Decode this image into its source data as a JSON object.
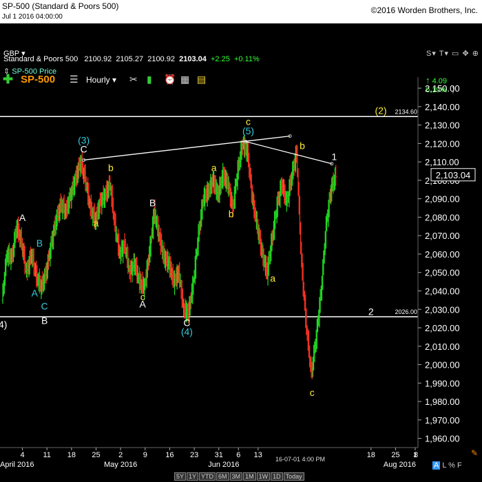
{
  "header": {
    "title": "SP-500 (Standard & Poors 500)",
    "datetime": "Jul 1 2016 04:00:00",
    "copyright": "©2016 Worden Brothers, Inc."
  },
  "toolbar": {
    "currency": "GBP",
    "symbol": "SP-500",
    "interval": "Hourly",
    "change_abs": "4.09",
    "change_pct": "0.19%",
    "right_tools": "S▾ T▾ ▭ ✥ ⊕"
  },
  "quote": {
    "name": "Standard & Poors 500",
    "open": "2100.92",
    "high": "2105.27",
    "low": "2100.92",
    "close": "2103.04",
    "change": "+2.25",
    "change_pct": "+0.11%"
  },
  "series_label": "SP-500 Price",
  "bottom": {
    "ranges": [
      "5Y",
      "1Y",
      "YTD",
      "6M",
      "3M",
      "1M",
      "1W",
      "1D",
      "Today"
    ],
    "mode_a": "A",
    "mode_rest": "L % F"
  },
  "chart_data": {
    "type": "bar",
    "subtype": "ohlc-hourly",
    "y_range": [
      1955,
      2156
    ],
    "y_ticks": [
      1960,
      1970,
      1980,
      1990,
      2000,
      2010,
      2020,
      2030,
      2040,
      2050,
      2060,
      2070,
      2080,
      2090,
      2100,
      2110,
      2120,
      2130,
      2140,
      2150
    ],
    "y_tick_labels": [
      "1,960.00",
      "1,970.00",
      "1,980.00",
      "1,990.00",
      "2,000.00",
      "2,010.00",
      "2,020.00",
      "2,030.00",
      "2,040.00",
      "2,050.00",
      "2,060.00",
      "2,070.00",
      "2,080.00",
      "2,090.00",
      "2,100.00",
      "2,110.00",
      "2,120.00",
      "2,130.00",
      "2,140.00",
      "2,150.00"
    ],
    "x_range": [
      0,
      84
    ],
    "x_ticks": [
      {
        "label": "4",
        "x": 4
      },
      {
        "label": "11",
        "x": 9
      },
      {
        "label": "18",
        "x": 14
      },
      {
        "label": "25",
        "x": 19
      },
      {
        "label": "2",
        "x": 24
      },
      {
        "label": "9",
        "x": 29
      },
      {
        "label": "16",
        "x": 34
      },
      {
        "label": "23",
        "x": 39
      },
      {
        "label": "31",
        "x": 44
      },
      {
        "label": "6",
        "x": 48
      },
      {
        "label": "13",
        "x": 52
      },
      {
        "label": "18",
        "x": 75
      },
      {
        "label": "25",
        "x": 80
      },
      {
        "label": "1",
        "x": 84
      }
    ],
    "extra_x_labels": [
      "8"
    ],
    "month_labels": [
      {
        "label": "April 2016",
        "x": 1
      },
      {
        "label": "May 2016",
        "x": 24
      },
      {
        "label": "Jun 2016",
        "x": 45
      },
      {
        "label": "Aug 2016",
        "x": 84
      }
    ],
    "x_cursor_label": "16-07-01 4:00 PM",
    "last_price_label": "2,103.04",
    "last_price": 2103.04,
    "horizontal_lines": [
      {
        "value": 2134.6,
        "label": "2134.60"
      },
      {
        "value": 2026.0,
        "label": "2026.00"
      }
    ],
    "trendlines": [
      {
        "points": [
          [
            16.5,
            2111
          ],
          [
            58.5,
            2124
          ]
        ]
      },
      {
        "points": [
          [
            49.5,
            2121
          ],
          [
            67,
            2109
          ]
        ]
      }
    ],
    "price_path": [
      [
        0,
        2035
      ],
      [
        1,
        2060
      ],
      [
        2,
        2058
      ],
      [
        3,
        2075
      ],
      [
        4,
        2066
      ],
      [
        5,
        2050
      ],
      [
        6,
        2060
      ],
      [
        7,
        2048
      ],
      [
        8,
        2042
      ],
      [
        9,
        2050
      ],
      [
        10,
        2065
      ],
      [
        11,
        2078
      ],
      [
        12,
        2087
      ],
      [
        13,
        2083
      ],
      [
        14,
        2092
      ],
      [
        15,
        2101
      ],
      [
        16,
        2110
      ],
      [
        17,
        2100
      ],
      [
        18,
        2085
      ],
      [
        19,
        2078
      ],
      [
        20,
        2088
      ],
      [
        21,
        2092
      ],
      [
        22,
        2098
      ],
      [
        23,
        2075
      ],
      [
        24,
        2060
      ],
      [
        25,
        2065
      ],
      [
        26,
        2050
      ],
      [
        27,
        2055
      ],
      [
        28,
        2045
      ],
      [
        29,
        2042
      ],
      [
        30,
        2060
      ],
      [
        31,
        2083
      ],
      [
        32,
        2070
      ],
      [
        33,
        2058
      ],
      [
        34,
        2055
      ],
      [
        35,
        2045
      ],
      [
        36,
        2050
      ],
      [
        37,
        2030
      ],
      [
        38,
        2028
      ],
      [
        39,
        2045
      ],
      [
        40,
        2070
      ],
      [
        41,
        2090
      ],
      [
        42,
        2094
      ],
      [
        43,
        2100
      ],
      [
        44,
        2092
      ],
      [
        45,
        2103
      ],
      [
        46,
        2098
      ],
      [
        47,
        2085
      ],
      [
        48,
        2105
      ],
      [
        49,
        2120
      ],
      [
        50,
        2115
      ],
      [
        51,
        2090
      ],
      [
        52,
        2075
      ],
      [
        53,
        2060
      ],
      [
        54,
        2050
      ],
      [
        55,
        2068
      ],
      [
        56,
        2086
      ],
      [
        57,
        2098
      ],
      [
        58,
        2088
      ],
      [
        59,
        2102
      ],
      [
        60,
        2115
      ],
      [
        61,
        2055
      ],
      [
        62,
        2020
      ],
      [
        63,
        1995
      ],
      [
        64,
        2015
      ],
      [
        65,
        2040
      ],
      [
        66,
        2075
      ],
      [
        67,
        2095
      ],
      [
        68,
        2103
      ]
    ],
    "annotations": [
      {
        "text": "A",
        "x": 4,
        "y": 2078,
        "color": "#ffffff"
      },
      {
        "text": "B",
        "x": 7.5,
        "y": 2064,
        "color": "#33ccdd"
      },
      {
        "text": "A",
        "x": 6.5,
        "y": 2037,
        "color": "#33ccdd"
      },
      {
        "text": "C",
        "x": 8.5,
        "y": 2030,
        "color": "#33ccdd"
      },
      {
        "text": "B",
        "x": 8.5,
        "y": 2022,
        "color": "#ffffff"
      },
      {
        "text": "(3)",
        "x": 16.5,
        "y": 2120,
        "color": "#33ccdd"
      },
      {
        "text": "C",
        "x": 16.5,
        "y": 2115,
        "color": "#ffffff"
      },
      {
        "text": "b",
        "x": 22,
        "y": 2105,
        "color": "#ffee33"
      },
      {
        "text": "a",
        "x": 19,
        "y": 2075,
        "color": "#ffee33"
      },
      {
        "text": "B",
        "x": 30.5,
        "y": 2086,
        "color": "#ffffff"
      },
      {
        "text": "c",
        "x": 28.5,
        "y": 2035,
        "color": "#ffee33"
      },
      {
        "text": "A",
        "x": 28.5,
        "y": 2031,
        "color": "#ffffff"
      },
      {
        "text": "C",
        "x": 37.5,
        "y": 2021,
        "color": "#ffffff"
      },
      {
        "text": "(4)",
        "x": 37.5,
        "y": 2016,
        "color": "#33ccdd"
      },
      {
        "text": "a",
        "x": 43,
        "y": 2105,
        "color": "#ffee33"
      },
      {
        "text": "b",
        "x": 46.5,
        "y": 2080,
        "color": "#ffee33"
      },
      {
        "text": "c",
        "x": 50,
        "y": 2130,
        "color": "#ffee33"
      },
      {
        "text": "(5)",
        "x": 50,
        "y": 2125,
        "color": "#33ccdd"
      },
      {
        "text": "a",
        "x": 55,
        "y": 2045,
        "color": "#ffee33"
      },
      {
        "text": "b",
        "x": 61,
        "y": 2117,
        "color": "#ffee33"
      },
      {
        "text": "1",
        "x": 67.5,
        "y": 2111,
        "color": "#ffffff"
      },
      {
        "text": "c",
        "x": 63,
        "y": 1983,
        "color": "#ffee33"
      },
      {
        "text": "(2)",
        "x": 77,
        "y": 2136,
        "color": "#ffee33"
      },
      {
        "text": "2",
        "x": 75,
        "y": 2027,
        "color": "#ffffff"
      },
      {
        "text": "4)",
        "x": 0,
        "y": 2020,
        "color": "#ffffff"
      }
    ]
  }
}
